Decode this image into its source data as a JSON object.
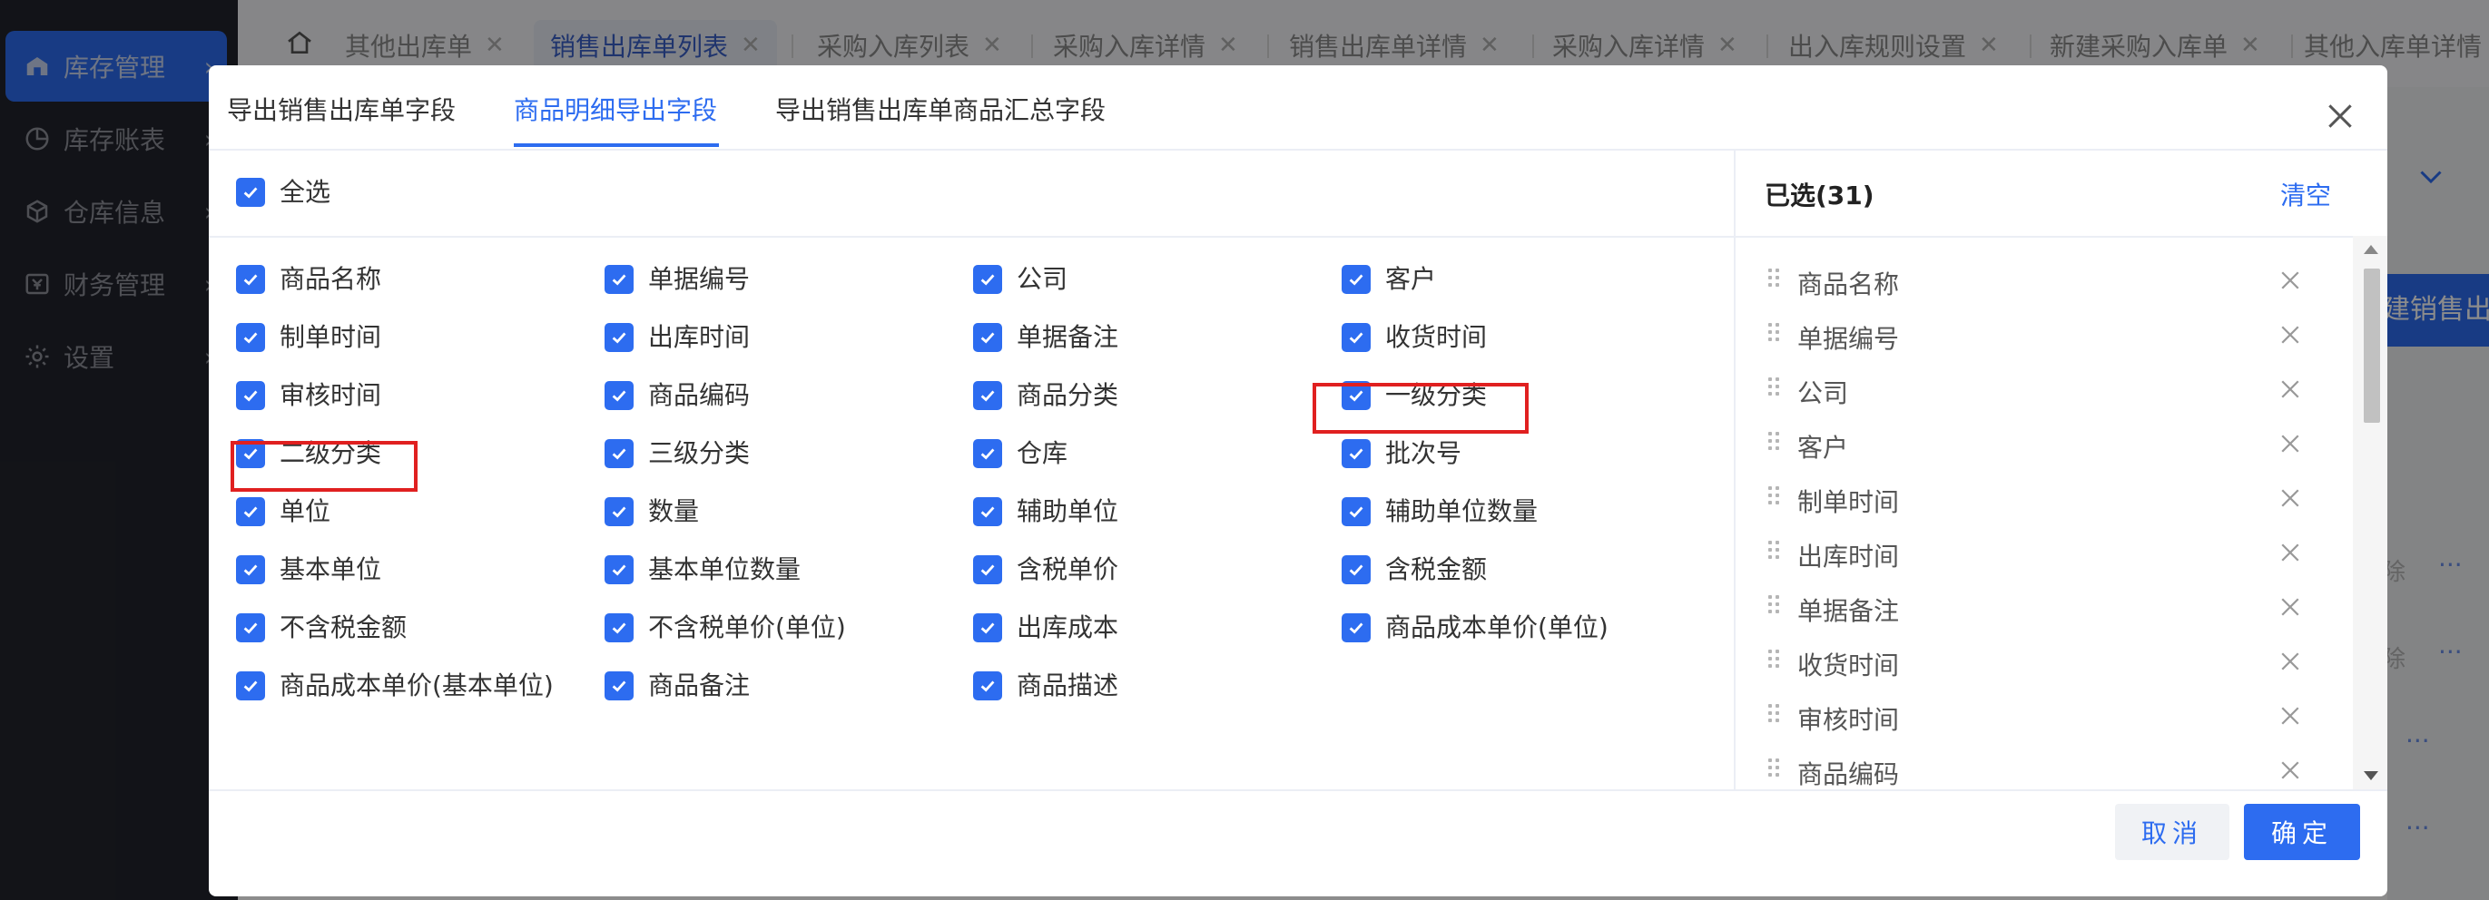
{
  "sidebar": {
    "items": [
      {
        "label": "库存管理",
        "active": true
      },
      {
        "label": "库存账表",
        "active": false
      },
      {
        "label": "仓库信息",
        "active": false
      },
      {
        "label": "财务管理",
        "active": false
      },
      {
        "label": "设置",
        "active": false
      }
    ]
  },
  "tabs": [
    {
      "label": "其他出库单",
      "active": false
    },
    {
      "label": "销售出库单列表",
      "active": true
    },
    {
      "label": "采购入库列表",
      "active": false
    },
    {
      "label": "采购入库详情",
      "active": false
    },
    {
      "label": "销售出库单详情",
      "active": false
    },
    {
      "label": "采购入库详情",
      "active": false
    },
    {
      "label": "出入库规则设置",
      "active": false
    },
    {
      "label": "新建采购入库单",
      "active": false
    },
    {
      "label": "其他入库单详情",
      "active": false
    }
  ],
  "background": {
    "primary_button": "建销售出库",
    "row_link": "除",
    "more": "···"
  },
  "modal": {
    "tabs": [
      {
        "label": "导出销售出库单字段",
        "active": false
      },
      {
        "label": "商品明细导出字段",
        "active": true
      },
      {
        "label": "导出销售出库单商品汇总字段",
        "active": false
      }
    ],
    "select_all": {
      "label": "全选",
      "checked": true
    },
    "fields": [
      [
        "商品名称",
        "单据编号",
        "公司",
        "客户"
      ],
      [
        "制单时间",
        "出库时间",
        "单据备注",
        "收货时间"
      ],
      [
        "审核时间",
        "商品编码",
        "商品分类",
        "一级分类"
      ],
      [
        "二级分类",
        "三级分类",
        "仓库",
        "批次号"
      ],
      [
        "单位",
        "数量",
        "辅助单位",
        "辅助单位数量"
      ],
      [
        "基本单位",
        "基本单位数量",
        "含税单价",
        "含税金额"
      ],
      [
        "不含税金额",
        "不含税单价(单位)",
        "出库成本",
        "商品成本单价(单位)"
      ],
      [
        "商品成本单价(基本单位)",
        "商品备注",
        "商品描述"
      ]
    ],
    "selected": {
      "title": "已选(31)",
      "clear_label": "清空",
      "items": [
        "商品名称",
        "单据编号",
        "公司",
        "客户",
        "制单时间",
        "出库时间",
        "单据备注",
        "收货时间",
        "审核时间",
        "商品编码"
      ]
    },
    "cancel_label": "取消",
    "ok_label": "确定"
  },
  "colors": {
    "primary": "#2d6cf0",
    "highlight_box": "#e02020",
    "sidebar_bg": "#22242c"
  },
  "icons": [
    "home-icon",
    "close-icon",
    "checkmark-icon",
    "drag-handle-icon",
    "chevron-down-icon"
  ]
}
